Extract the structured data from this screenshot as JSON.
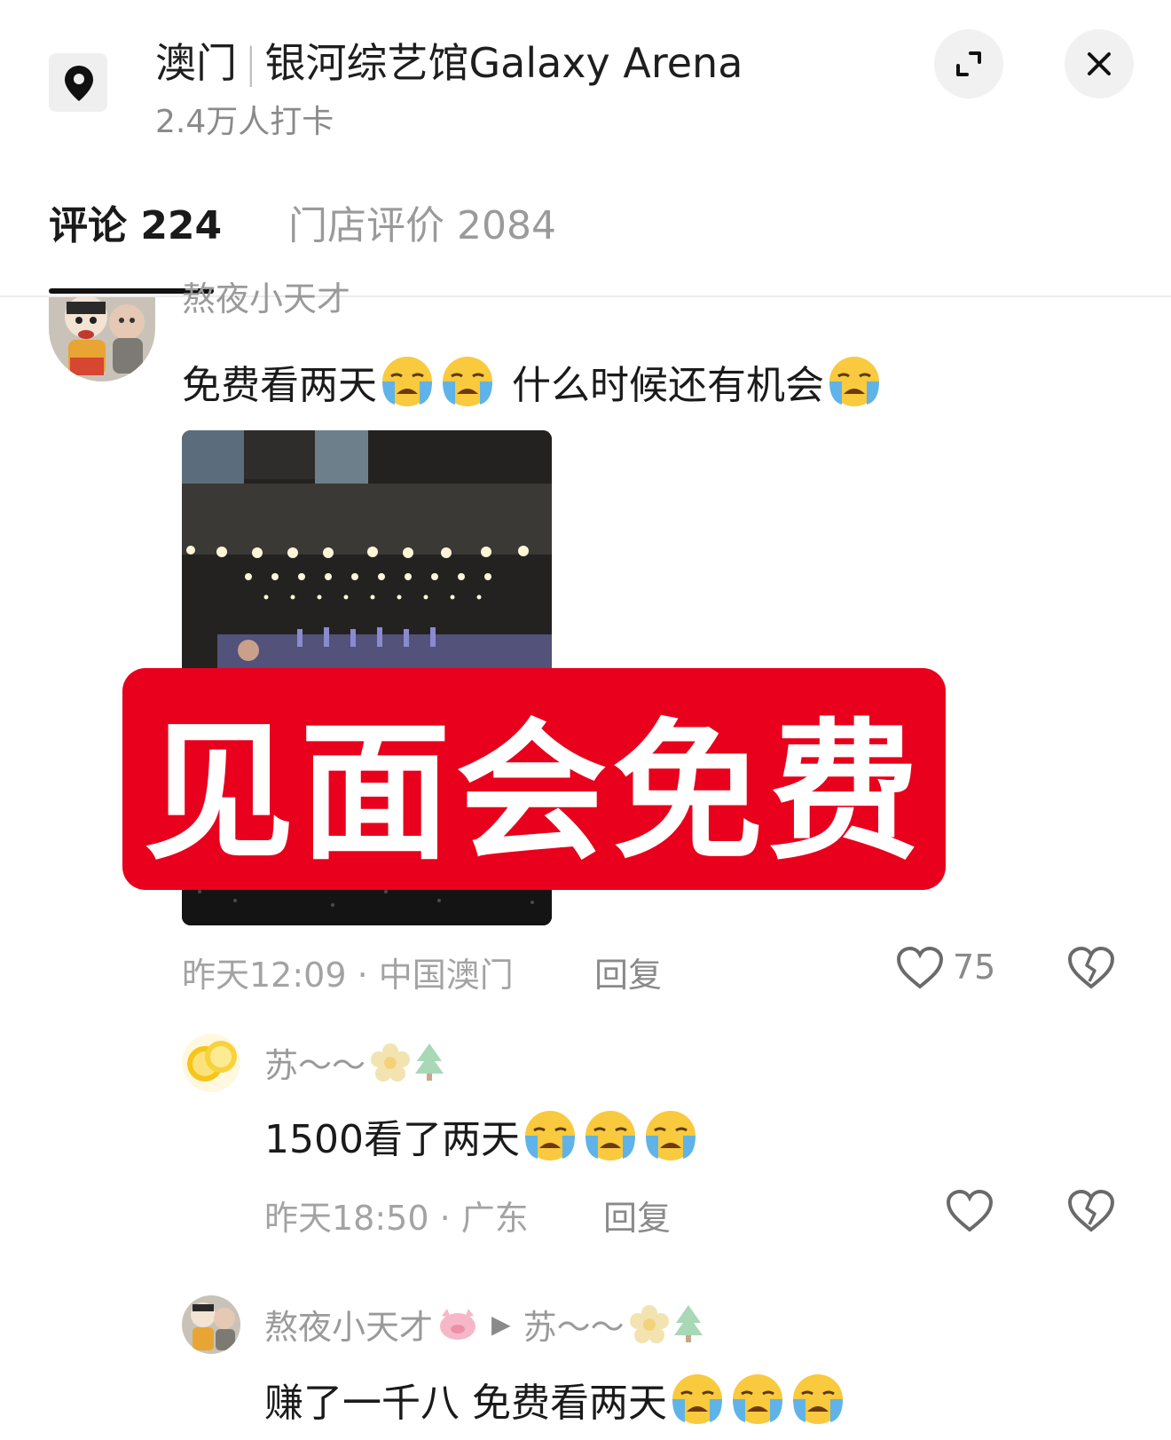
{
  "header": {
    "city": "澳门",
    "venue": "银河综艺馆Galaxy Arena",
    "checkins": "2.4万人打卡"
  },
  "tabs": [
    {
      "label": "评论 224",
      "active": true
    },
    {
      "label": "门店评价 2084",
      "active": false
    }
  ],
  "colors": {
    "banner": "#e8001c",
    "muted": "#9a9a9a"
  },
  "comments": [
    {
      "user": "熬夜小天才",
      "text_a": "免费看两天",
      "text_b": "什么时候还有机会",
      "time_location": "昨天12:09 · 中国澳门",
      "reply_label": "回复",
      "likes": "75",
      "icons": [
        "pin-icon",
        "crying-emoji-icon",
        "heart-icon",
        "broken-heart-icon"
      ]
    },
    {
      "user": "苏～～",
      "text": "1500看了两天",
      "time_location": "昨天18:50 · 广东",
      "reply_label": "回复"
    },
    {
      "user": "熬夜小天才",
      "reply_to": "苏～～",
      "text": "赚了一千八 免费看两天"
    }
  ],
  "banner": {
    "text": "见面会免费"
  }
}
